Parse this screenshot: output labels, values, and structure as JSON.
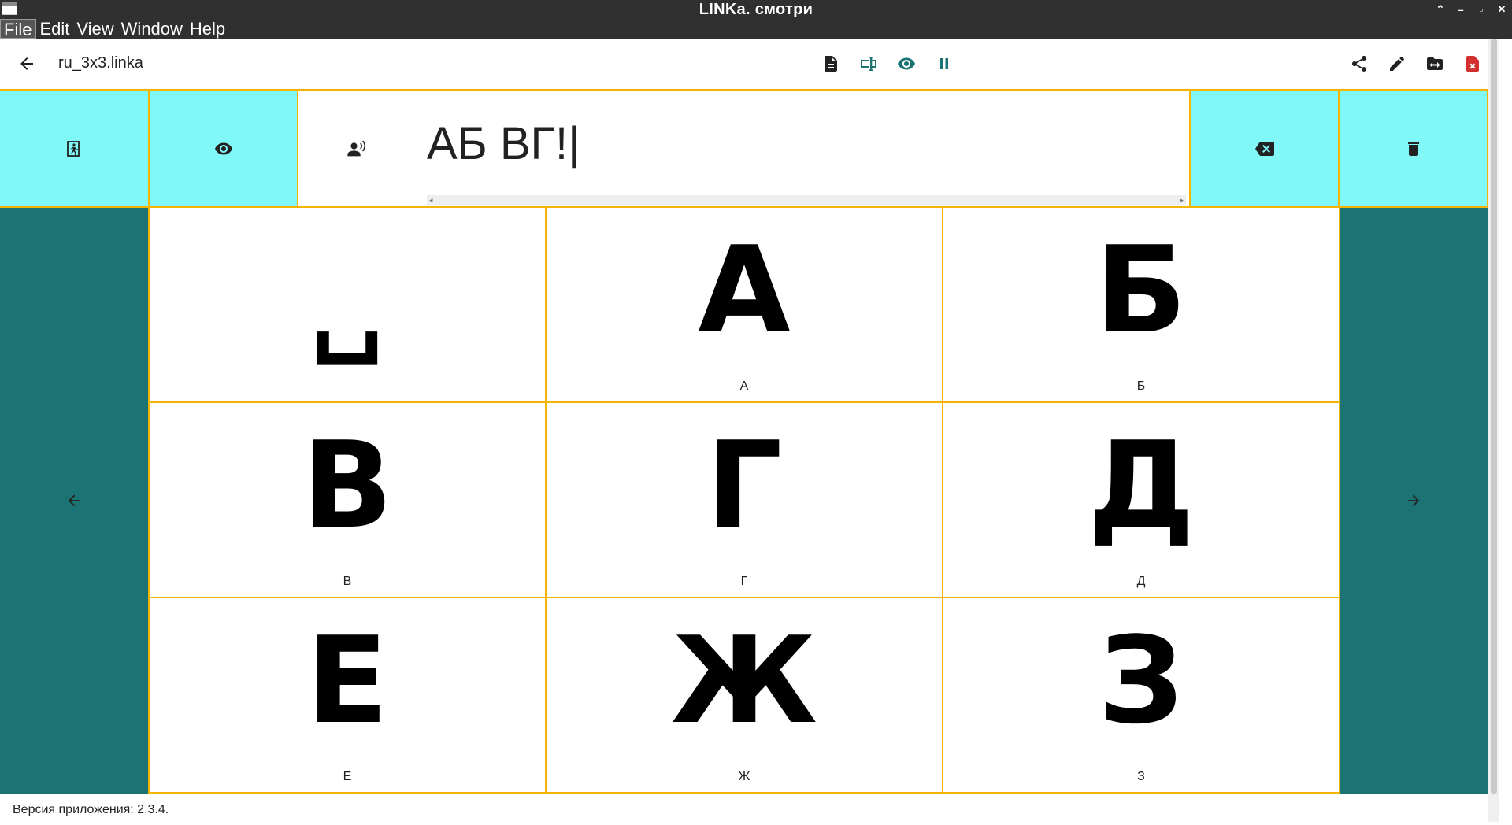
{
  "window": {
    "title": "LINKa. смотри",
    "controls": [
      "⌃",
      "–",
      "▫",
      "✕"
    ]
  },
  "menubar": {
    "items": [
      "File",
      "Edit",
      "View",
      "Window",
      "Help"
    ]
  },
  "toolbar": {
    "filename": "ru_3x3.linka",
    "center_icons": [
      "document-icon",
      "text-cursor-icon",
      "eye-icon",
      "pause-icon"
    ],
    "right_icons": [
      "share-icon",
      "edit-icon",
      "folder-swap-icon",
      "delete-file-icon"
    ],
    "accent": "#1b7373",
    "danger": "#d32f2f"
  },
  "top_row": {
    "output_text": "АБ ВГ!|",
    "left_tiles": [
      "exit-icon",
      "eye-icon"
    ],
    "right_tiles": [
      "backspace-icon",
      "trash-icon"
    ],
    "tile_color": "#80f8f8"
  },
  "grid": {
    "cells": [
      {
        "glyph": "␣",
        "caption": ""
      },
      {
        "glyph": "А",
        "caption": "А"
      },
      {
        "glyph": "Б",
        "caption": "Б"
      },
      {
        "glyph": "В",
        "caption": "В"
      },
      {
        "glyph": "Г",
        "caption": "Г"
      },
      {
        "glyph": "Д",
        "caption": "Д"
      },
      {
        "glyph": "Е",
        "caption": "Е"
      },
      {
        "glyph": "Ж",
        "caption": "Ж"
      },
      {
        "glyph": "З",
        "caption": "З"
      }
    ],
    "border_color": "#f4b400",
    "side_color": "#1b7373"
  },
  "status": {
    "version_text": "Версия приложения: 2.3.4."
  }
}
